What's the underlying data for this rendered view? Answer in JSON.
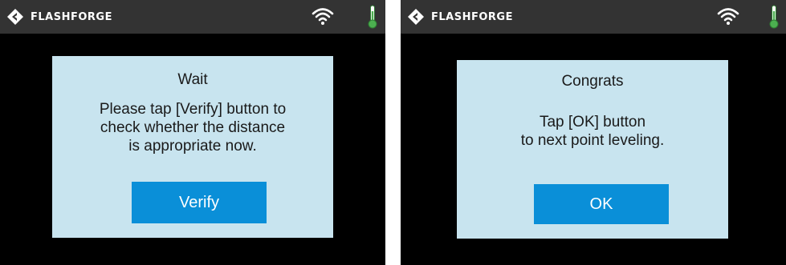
{
  "colors": {
    "background": "#000000",
    "topbar": "#333333",
    "dialog": "#c8e4ef",
    "button": "#0a8fd8",
    "thermometer": "#4caf50"
  },
  "screens": [
    {
      "header": {
        "brand": "FLASHFORGE",
        "icons": [
          "flashforge-logo-icon",
          "wifi-icon",
          "thermometer-icon"
        ]
      },
      "dialog": {
        "title": "Wait",
        "message_lines": [
          "Please tap [Verify] button to",
          "check whether the distance",
          "is appropriate now."
        ],
        "button_label": "Verify"
      }
    },
    {
      "header": {
        "brand": "FLASHFORGE",
        "icons": [
          "flashforge-logo-icon",
          "wifi-icon",
          "thermometer-icon"
        ]
      },
      "dialog": {
        "title": "Congrats",
        "message_lines": [
          "Tap [OK] button",
          "to next point leveling."
        ],
        "button_label": "OK"
      }
    }
  ]
}
